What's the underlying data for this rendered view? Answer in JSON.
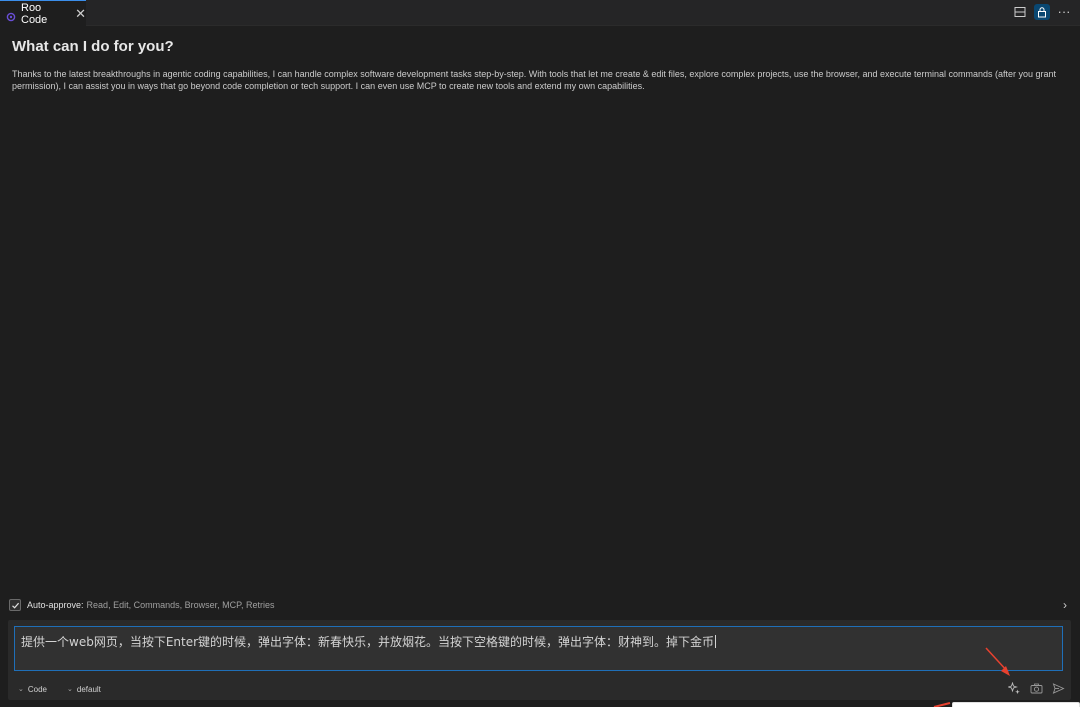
{
  "tab": {
    "title": "Roo Code",
    "close_glyph": "✕",
    "icon": "roo-logo-icon"
  },
  "tab_actions": {
    "split_icon": "split-editor-icon",
    "lock_icon": "lock-icon",
    "more_glyph": "···"
  },
  "welcome": {
    "heading": "What can I do for you?",
    "intro": "Thanks to the latest breakthroughs in agentic coding capabilities, I can handle complex software development tasks step-by-step. With tools that let me create & edit files, explore complex projects, use the browser, and execute terminal commands (after you grant permission), I can assist you in ways that go beyond code completion or tech support. I can even use MCP to create new tools and extend my own capabilities."
  },
  "auto_approve": {
    "label": "Auto-approve:",
    "items": "Read, Edit, Commands, Browser, MCP, Retries",
    "checked": true,
    "chevron": "›"
  },
  "input": {
    "value": "提供一个web网页，当按下Enter键的时候，弹出字体：新春快乐，并放烟花。当按下空格键的时候，弹出字体：财神到。掉下金币"
  },
  "mode_select": {
    "value": "Code",
    "chevron": "⌄"
  },
  "profile_select": {
    "value": "default",
    "chevron": "⌄"
  },
  "toolbar": {
    "enhance_icon": "sparkle-icon",
    "image_icon": "camera-icon",
    "send_icon": "send-icon"
  },
  "colors": {
    "background": "#1e1e1e",
    "input_border": "#1f6fb8",
    "annotation": "#e8412f"
  }
}
